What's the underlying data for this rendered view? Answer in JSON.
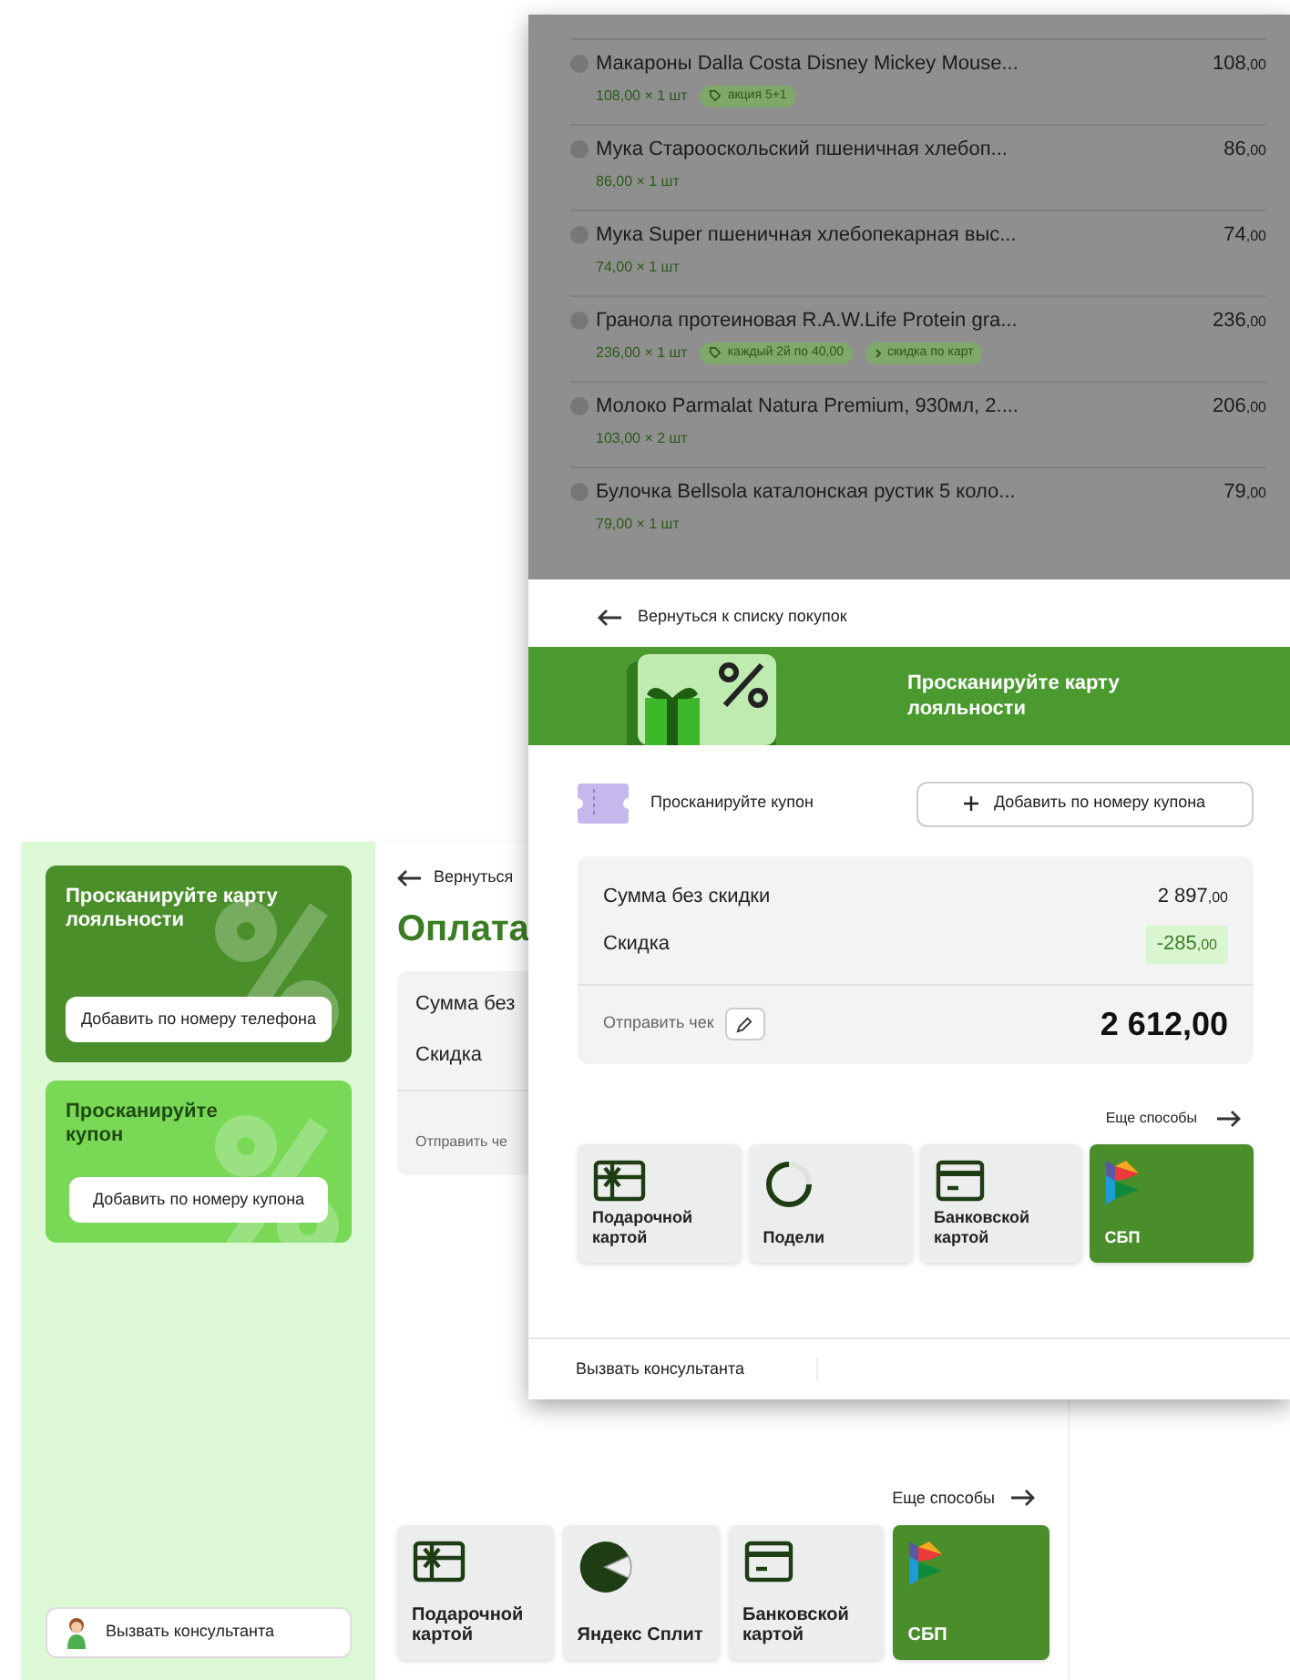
{
  "front": {
    "cart_items": [
      {
        "name": "Макароны Dalla Costa Disney Mickey Mouse...",
        "qty": "108,00 × 1 шт",
        "tags": [
          {
            "kind": "promo",
            "text": "акция 5+1"
          }
        ],
        "price": "108",
        "cents": ",00"
      },
      {
        "name": "Мука Старооскольский пшеничная хлебоп...",
        "qty": "86,00 × 1 шт",
        "price": "86",
        "cents": ",00"
      },
      {
        "name": "Мука Super пшеничная хлебопекарная выс...",
        "qty": "74,00 × 1 шт",
        "price": "74",
        "cents": ",00"
      },
      {
        "name": "Гранола протеиновая R.A.W.Life Protein gra...",
        "qty": "236,00 × 1 шт",
        "tags": [
          {
            "kind": "promo",
            "text": "каждый 2й по 40,00"
          },
          {
            "kind": "card",
            "text": "скидка по карт"
          }
        ],
        "price": "236",
        "cents": ",00"
      },
      {
        "name": "Молоко Parmalat Natura Premium, 930мл, 2....",
        "qty": "103,00 × 2 шт",
        "price": "206",
        "cents": ",00"
      },
      {
        "name": "Булочка Bellsola каталонская рустик 5 коло...",
        "qty": "79,00 × 1 шт",
        "price": "79",
        "cents": ",00"
      }
    ],
    "back_link": "Вернуться к списку покупок",
    "loyalty_banner": "Просканируйте карту лояльности",
    "coupon_label": "Просканируйте купон",
    "coupon_button": "Добавить по номеру купона",
    "summary": {
      "rows": [
        {
          "kind": "plain",
          "label": "Сумма без скидки",
          "amount": "2 897",
          "cents": ",00"
        },
        {
          "kind": "discount",
          "label": "Скидка",
          "amount": "-285",
          "cents": ",00"
        }
      ],
      "receipt_label": "Отправить чек",
      "total": "2 612,00"
    },
    "more_methods": "Еще способы",
    "payment_methods": [
      {
        "kind": "gift",
        "label": "Подарочной картой",
        "selected": false
      },
      {
        "kind": "podeli",
        "label": "Подели",
        "selected": false
      },
      {
        "kind": "bank",
        "label": "Банковской картой",
        "selected": false
      },
      {
        "kind": "sbp",
        "label": "СБП",
        "selected": true
      }
    ],
    "consultant": "Вызвать консультанта"
  },
  "back": {
    "loyalty_card": {
      "title": "Просканируйте карту лояльности",
      "button": "Добавить по номеру телефона"
    },
    "coupon_card": {
      "title": "Просканируйте купон",
      "button": "Добавить по номеру купона"
    },
    "consultant": "Вызвать консультанта",
    "back_link": "Вернуться",
    "title": "Оплата",
    "summary": {
      "rows": [
        "Сумма без",
        "Скидка"
      ],
      "receipt_label": "Отправить че"
    },
    "more_methods": "Еще способы",
    "payment_methods": [
      {
        "kind": "gift",
        "label": "Подарочной картой",
        "selected": false
      },
      {
        "kind": "split",
        "label": "Яндекс Сплит",
        "selected": false
      },
      {
        "kind": "bank",
        "label": "Банковской картой",
        "selected": false
      },
      {
        "kind": "sbp",
        "label": "СБП",
        "selected": true
      }
    ]
  }
}
